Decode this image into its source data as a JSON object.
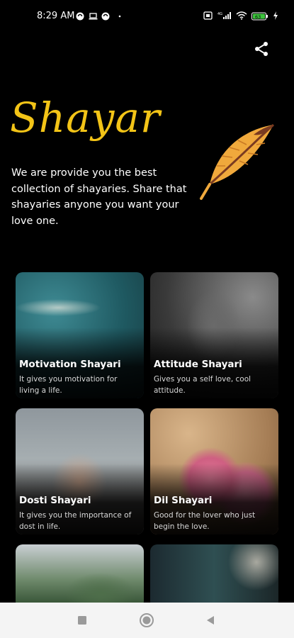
{
  "status_bar": {
    "time": "8:29 AM",
    "left_icons": [
      "whatsapp-icon",
      "laptop-icon",
      "whatsapp-icon",
      "dot-icon"
    ],
    "right_icons": [
      "sim-icon",
      "signal-icon",
      "wifi-icon",
      "battery-icon",
      "charging-icon"
    ],
    "battery_level": "63"
  },
  "header": {
    "share_icon": "share-icon"
  },
  "hero": {
    "title": "Shayar",
    "description": "We are provide you the best collection of shayaries. Share that shayaries anyone you want your love one.",
    "accent_color": "#f3c417",
    "image_icon": "feather-icon"
  },
  "categories": [
    {
      "title": "Motivation Shayari",
      "desc": "It gives you motivation for living a life."
    },
    {
      "title": "Attitude Shayari",
      "desc": "Gives you a self love, cool attitude."
    },
    {
      "title": "Dosti Shayari",
      "desc": "It gives you the importance of dost in life."
    },
    {
      "title": "Dil Shayari",
      "desc": "Good for the lover who just begin the love."
    }
  ],
  "nav_bar": {
    "icons": [
      "recents-square-icon",
      "home-circle-icon",
      "back-triangle-icon"
    ]
  }
}
